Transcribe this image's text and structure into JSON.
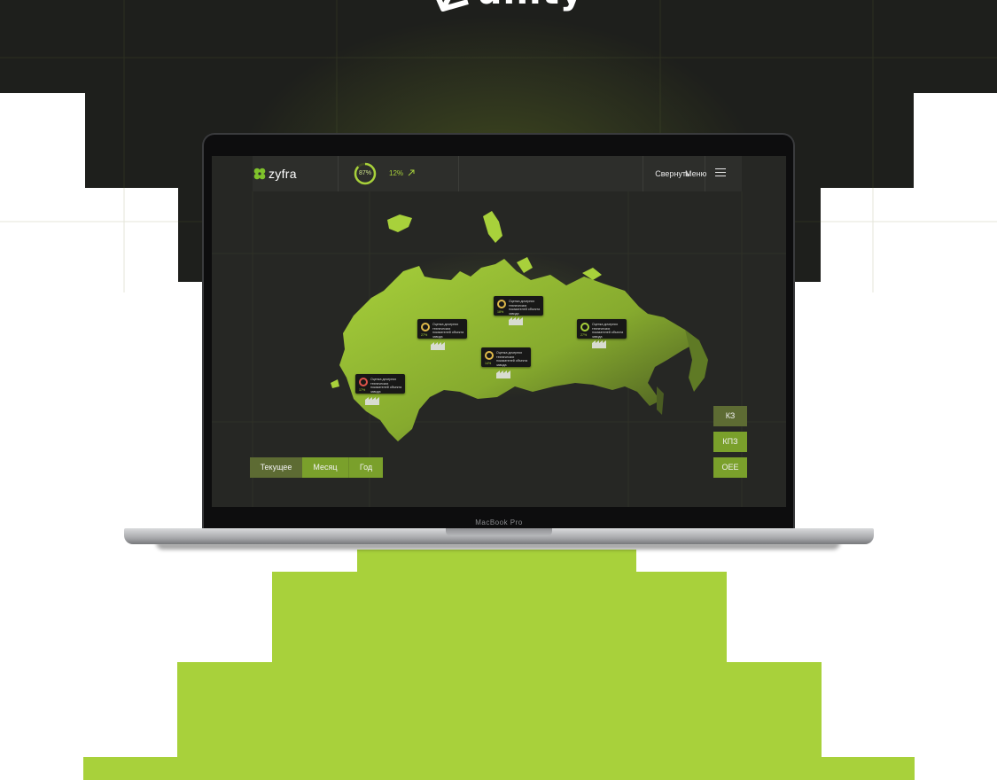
{
  "brand_logo": {
    "wordmark": "unity"
  },
  "app": {
    "logo_text": "zyfra",
    "indicator": {
      "percent_label": "87%",
      "percent_value": 87,
      "trend_label": "12%",
      "trend_icon": "arrow-up-right-icon"
    },
    "header": {
      "collapse_label": "Свернуть",
      "menu_label": "Меню",
      "menu_icon": "hamburger-icon"
    },
    "map": {
      "markers": [
        {
          "percent": "83%",
          "text": "Оценка дочерних технических показателей объекта завода",
          "ring_color": "#e0534a",
          "value_text": "17%"
        },
        {
          "percent": "73%",
          "text": "Оценка дочерних технических показателей объекта завода",
          "ring_color": "#e0b94a",
          "value_text": "27%"
        },
        {
          "percent": "82%",
          "text": "Оценка дочерних технических показателей объекта завода",
          "ring_color": "#e0b94a",
          "value_text": "18%"
        },
        {
          "percent": "73%",
          "text": "Оценка дочерних технических показателей объекта завода",
          "ring_color": "#a8d13b",
          "value_text": "27%"
        },
        {
          "percent": "86%",
          "text": "Оценка дочерних технических показателей объекта завода",
          "ring_color": "#e0b94a",
          "value_text": "14%"
        }
      ]
    },
    "period_buttons": [
      "Текущее",
      "Месяц",
      "Год"
    ],
    "metric_buttons": [
      "КЗ",
      "КПЗ",
      "OEE"
    ]
  },
  "device": {
    "label": "MacBook Pro"
  },
  "colors": {
    "accent": "#a8d13b",
    "dark_bg": "#1e1f1c",
    "screen_bg": "#262724"
  }
}
